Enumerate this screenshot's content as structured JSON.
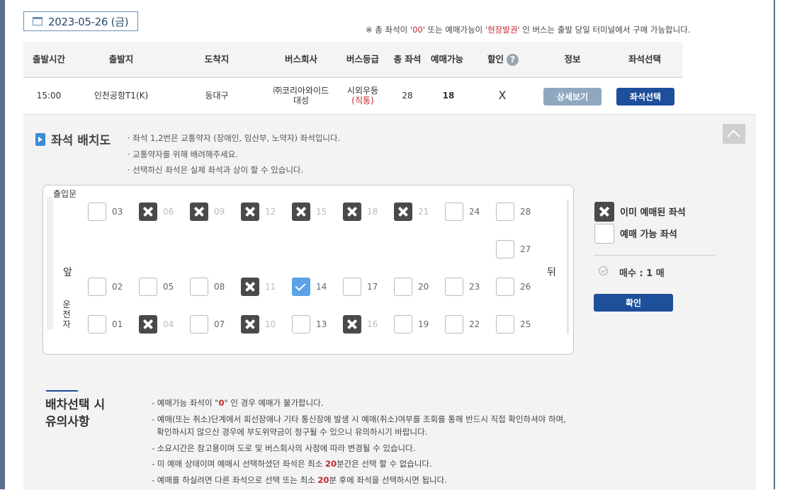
{
  "date": {
    "icon": "calendar-icon",
    "text": "2023-05-26 (금)"
  },
  "notice": {
    "pre": "※ 총 좌석이 '",
    "zero": "00",
    "mid": "' 또는 예매가능이 '",
    "onsite": "현장발권",
    "post": "' 인 버스는 출발 당일 터미널에서 구매 가능합니다."
  },
  "table": {
    "headers": {
      "departure_time": "출발시간",
      "origin": "출발지",
      "destination": "도착지",
      "bus_company": "버스회사",
      "bus_class": "버스등급",
      "total_seats": "총 좌석",
      "available": "예매가능",
      "discount": "할인",
      "help": "?",
      "info": "정보",
      "seat_select": "좌석선택"
    },
    "row": {
      "departure_time": "15:00",
      "origin": "인천공항T1(K)",
      "destination": "동대구",
      "bus_company_line1": "㈜코리아와이드",
      "bus_company_line2": "대성",
      "bus_class_line1": "시외우등",
      "bus_class_line2": "(직통)",
      "total_seats": "28",
      "available": "18",
      "discount": "X",
      "detail_button": "상세보기",
      "select_button": "좌석선택"
    }
  },
  "seat_map": {
    "title": "좌석 배치도",
    "notes": [
      "· 좌석 1,2번은 교통약자 (장애인, 임산부, 노약자) 좌석입니다.",
      "· 교통약자를 위해 배려해주세요.",
      "· 선택하신 좌석은 실제 좌석과 상이 할 수 있습니다."
    ],
    "door_label": "출입문",
    "front_label": "앞",
    "back_label": "뒤",
    "driver_label": [
      "운",
      "전",
      "자"
    ],
    "seats": [
      {
        "num": "03",
        "status": "available"
      },
      {
        "num": "06",
        "status": "booked"
      },
      {
        "num": "09",
        "status": "booked"
      },
      {
        "num": "12",
        "status": "booked"
      },
      {
        "num": "15",
        "status": "booked"
      },
      {
        "num": "18",
        "status": "booked"
      },
      {
        "num": "21",
        "status": "booked"
      },
      {
        "num": "24",
        "status": "available"
      },
      {
        "num": "28",
        "status": "available"
      },
      {
        "num": "27",
        "status": "available"
      },
      {
        "num": "02",
        "status": "available"
      },
      {
        "num": "05",
        "status": "available"
      },
      {
        "num": "08",
        "status": "available"
      },
      {
        "num": "11",
        "status": "booked"
      },
      {
        "num": "14",
        "status": "selected"
      },
      {
        "num": "17",
        "status": "available"
      },
      {
        "num": "20",
        "status": "available"
      },
      {
        "num": "23",
        "status": "available"
      },
      {
        "num": "26",
        "status": "available"
      },
      {
        "num": "01",
        "status": "available"
      },
      {
        "num": "04",
        "status": "booked"
      },
      {
        "num": "07",
        "status": "available"
      },
      {
        "num": "10",
        "status": "booked"
      },
      {
        "num": "13",
        "status": "available"
      },
      {
        "num": "16",
        "status": "booked"
      },
      {
        "num": "19",
        "status": "available"
      },
      {
        "num": "22",
        "status": "available"
      },
      {
        "num": "25",
        "status": "available"
      }
    ]
  },
  "legend": {
    "booked": "이미 예매된 좌석",
    "available": "예매 가능 좌석",
    "count": "매수 : 1 매",
    "confirm_button": "확인"
  },
  "caution": {
    "title_line1": "배차선택 시",
    "title_line2": "유의사항",
    "items": [
      {
        "pre": "- 예매가능 좌석이 \"",
        "em": "0",
        "post": "\" 인 경우 예매가 불가합니다."
      },
      {
        "pre": "- 예매(또는 취소)단계에서 회선장애나 기타 통신장애 발생 시 예매(취소)여부를 조회를 통해 반드시 직접 확인하셔야 하며,",
        "em": "",
        "post": ""
      },
      {
        "pre": "  확인하시지 않으신 경우에 부도위약금이 청구될 수 있으니 유의하시기 바랍니다.",
        "em": "",
        "post": ""
      },
      {
        "pre": "- 소요시간은 참고용이며 도로 및 버스회사의 사정에 따라 변경될 수 있습니다.",
        "em": "",
        "post": ""
      },
      {
        "pre": "- 미 예매 상태이며 예매시 선택하셨던 좌석은 최소 ",
        "em": "20",
        "post": "분간은 선택 할 수 없습니다."
      },
      {
        "pre": "- 예매를 하실려면 다른 좌석으로 선택 또는 최소 ",
        "em": "20",
        "post": "분 후에 좌석을 선택하시면 됩니다."
      }
    ]
  },
  "colors": {
    "primary": "#1e4f9a",
    "secondary_button": "#8fa8bf",
    "booked": "#4a4a4a",
    "selected": "#5ba2e8",
    "accent_red": "#c0282f"
  }
}
